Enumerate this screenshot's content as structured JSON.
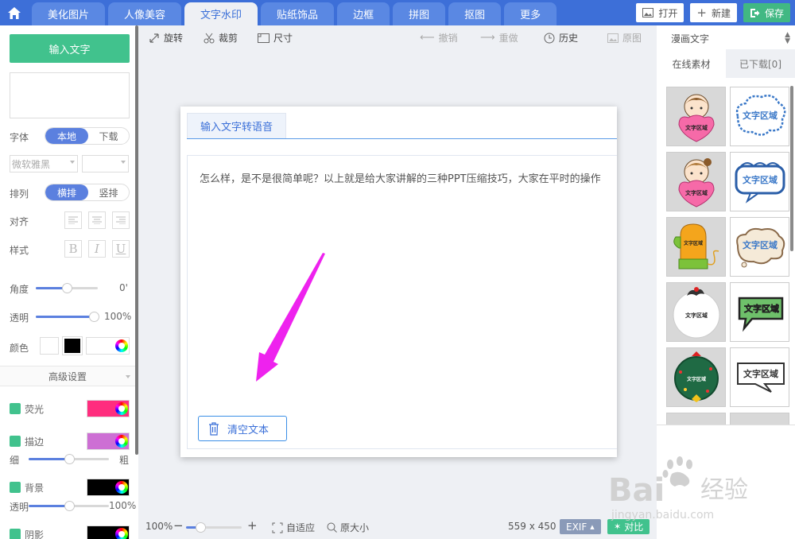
{
  "nav": {
    "tabs": [
      {
        "label": "美化图片"
      },
      {
        "label": "人像美容"
      },
      {
        "label": "文字水印"
      },
      {
        "label": "贴纸饰品"
      },
      {
        "label": "边框"
      },
      {
        "label": "拼图"
      },
      {
        "label": "抠图"
      },
      {
        "label": "更多"
      }
    ],
    "active_tab": "文字水印",
    "open_label": "打开",
    "new_label": "新建",
    "save_label": "保存"
  },
  "left": {
    "input_button": "输入文字",
    "font_label": "字体",
    "font_source": {
      "local": "本地",
      "download": "下载"
    },
    "font_name": "微软雅黑",
    "layout_label": "排列",
    "layout": {
      "horizontal": "横排",
      "vertical": "竖排"
    },
    "align_label": "对齐",
    "style_label": "样式",
    "style_buttons": {
      "bold": "B",
      "italic": "I",
      "underline": "U"
    },
    "angle_label": "角度",
    "angle_value": "0'",
    "angle_fraction": 0.5,
    "opacity_label": "透明",
    "opacity_value": "100%",
    "opacity_fraction": 1.0,
    "color_label": "颜色",
    "advanced_label": "高级设置",
    "glow_label": "荧光",
    "stroke_label": "描边",
    "stroke_thin": "细",
    "stroke_thick": "粗",
    "stroke_fraction": 0.5,
    "bg_label": "背景",
    "bg_opacity_label": "透明",
    "bg_opacity_value": "100%",
    "bg_opacity_fraction": 0.5,
    "shadow_label": "阴影"
  },
  "colors": {
    "accent": "#3d6fd8",
    "green": "#41c28d",
    "glow": "#ff2d7e",
    "stroke": "#cd6fd4",
    "bg": "#000000",
    "arrow": "#ee22ee"
  },
  "toolbar": {
    "rotate": "旋转",
    "crop": "裁剪",
    "size": "尺寸",
    "undo": "撤销",
    "redo": "重做",
    "history": "历史",
    "original": "原图"
  },
  "dialog": {
    "tab_label": "输入文字转语音",
    "text": "怎么样，是不是很简单呢？以上就是给大家讲解的三种PPT压缩技巧，大家在平时的操作",
    "clear_button": "清空文本"
  },
  "status": {
    "zoom": "100%",
    "zoom_fraction": 0.25,
    "fit": "自适应",
    "original_size": "原大小",
    "dimensions": "559 x 450",
    "exif": "EXIF",
    "compare": "对比"
  },
  "right": {
    "category": "漫画文字",
    "tab_online": "在线素材",
    "tab_downloaded": "已下载[0]",
    "sticker_text": "文字区域"
  },
  "watermark": {
    "brand": "Bai",
    "brand_cn": "经验",
    "url": "jingyan.baidu.com"
  }
}
